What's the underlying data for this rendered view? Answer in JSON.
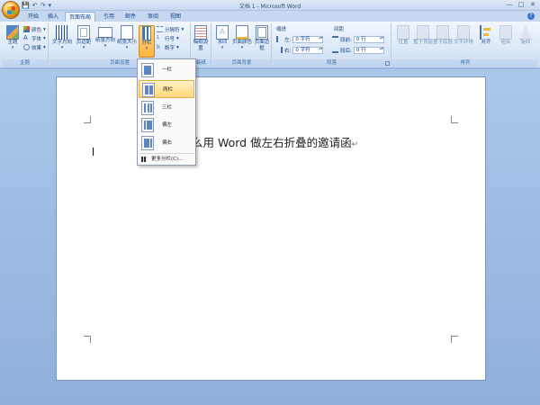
{
  "window": {
    "title": "文档 1 - Microsoft Word",
    "quick_access": [
      "💾",
      "↶",
      "↷",
      "▾"
    ],
    "controls": [
      "—",
      "□",
      "✕"
    ]
  },
  "tabs": [
    {
      "label": "开始"
    },
    {
      "label": "插入"
    },
    {
      "label": "页面布局",
      "active": true
    },
    {
      "label": "引用"
    },
    {
      "label": "邮件"
    },
    {
      "label": "审阅"
    },
    {
      "label": "视图"
    }
  ],
  "ribbon": {
    "themes": {
      "big_label": "主题",
      "items": [
        "颜色",
        "字体",
        "效果"
      ],
      "group_label": "主题"
    },
    "page_setup": {
      "buttons": [
        "文字方向",
        "页边距",
        "纸张方向",
        "纸张大小",
        "分栏"
      ],
      "small_items": [
        "分隔符",
        "行号",
        "断字"
      ],
      "group_label": "页面设置"
    },
    "draft": {
      "button": "稿纸设置",
      "group_label": "稿纸"
    },
    "page_background": {
      "buttons": [
        "水印",
        "页面颜色",
        "页面边框"
      ],
      "group_label": "页面背景"
    },
    "paragraph": {
      "indent_label": "缩进",
      "spacing_label": "间距",
      "left_label": "左:",
      "right_label": "右:",
      "before_label": "段前:",
      "after_label": "段后:",
      "left_value": "0 字符",
      "right_value": "0 字符",
      "before_value": "0 行",
      "after_value": "0 行",
      "group_label": "段落"
    },
    "arrange": {
      "buttons": [
        "位置",
        "置于顶层",
        "置于底层",
        "文字环绕",
        "对齐",
        "组合",
        "旋转"
      ],
      "group_label": "排列"
    }
  },
  "columns_menu": {
    "items": [
      {
        "label": "一栏"
      },
      {
        "label": "两栏",
        "highlighted": true
      },
      {
        "label": "三栏"
      },
      {
        "label": "偏左"
      },
      {
        "label": "偏右"
      }
    ],
    "more": "更多分栏(C)..."
  },
  "document": {
    "text": "么用 Word 做左右折叠的邀请函",
    "paragraph_mark": "↵"
  },
  "colors": {
    "accent": "#15428b",
    "highlight": "#ffd77a"
  }
}
